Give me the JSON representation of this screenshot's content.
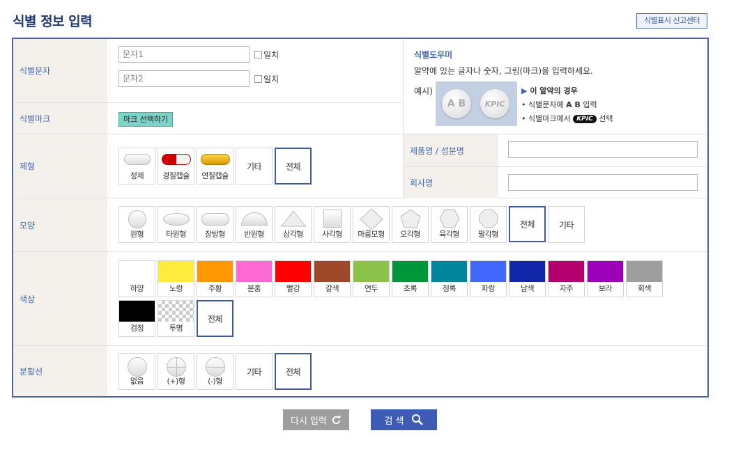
{
  "header": {
    "title": "식별 정보 입력",
    "report_link": "식별표시 신고센터"
  },
  "mark_chars": {
    "label": "식별문자",
    "input1_placeholder": "문자1",
    "input2_placeholder": "문자2",
    "match_label": "일치"
  },
  "mark": {
    "label": "식별마크",
    "select_button": "마크 선택하기"
  },
  "helper": {
    "title": "식별도우미",
    "desc": "알약에 있는 글자나 숫자, 그림(마크)을 입력하세요.",
    "example_label": "예시)",
    "pill1_text": "A B",
    "pill2_text": "KPIC",
    "case_title": "이 알약의 경우",
    "bullet1_pre": "• 식별문자에 ",
    "bullet1_bold": "A B",
    "bullet1_post": " 입력",
    "bullet2_pre": "• 식별마크에서 ",
    "bullet2_badge": "KPIC",
    "bullet2_post": " 선택"
  },
  "product": {
    "label": "제품명 / 성분명"
  },
  "company": {
    "label": "회사명"
  },
  "form": {
    "label": "제형",
    "options": [
      "정제",
      "경질캡슐",
      "연질캡슐"
    ],
    "other": "기타",
    "all": "전체"
  },
  "shape": {
    "label": "모양",
    "options": [
      "원형",
      "타원형",
      "장방형",
      "반원형",
      "삼각형",
      "사각형",
      "마름모형",
      "오각형",
      "육각형",
      "팔각형"
    ],
    "all": "전체",
    "other": "기타"
  },
  "color": {
    "label": "색상",
    "options": [
      {
        "name": "하양",
        "hex": "#ffffff"
      },
      {
        "name": "노랑",
        "hex": "#ffeb3b"
      },
      {
        "name": "주황",
        "hex": "#ff9800"
      },
      {
        "name": "분홍",
        "hex": "#ff69d4"
      },
      {
        "name": "빨강",
        "hex": "#ff0000"
      },
      {
        "name": "갈색",
        "hex": "#a0482a"
      },
      {
        "name": "연두",
        "hex": "#8bc34a"
      },
      {
        "name": "초록",
        "hex": "#00963a"
      },
      {
        "name": "청록",
        "hex": "#00869c"
      },
      {
        "name": "파랑",
        "hex": "#4169ff"
      },
      {
        "name": "남색",
        "hex": "#1126a8"
      },
      {
        "name": "자주",
        "hex": "#b4006f"
      },
      {
        "name": "보라",
        "hex": "#9c00b8"
      },
      {
        "name": "회색",
        "hex": "#9e9e9e"
      },
      {
        "name": "검정",
        "hex": "#000000"
      },
      {
        "name": "투명",
        "hex": "transparent"
      }
    ],
    "all": "전체"
  },
  "scoreline": {
    "label": "분할선",
    "options": [
      "없음",
      "(+)형",
      "(-)형"
    ],
    "other": "기타",
    "all": "전체"
  },
  "actions": {
    "reset": "다시 입력",
    "search": "검 색"
  }
}
